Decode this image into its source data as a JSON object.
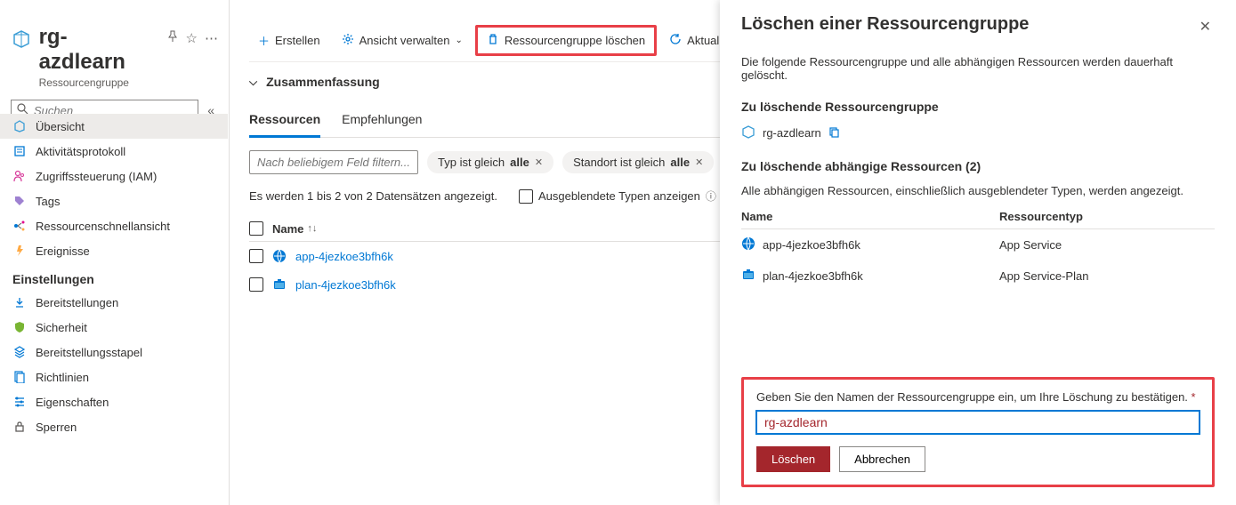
{
  "header": {
    "title": "rg-azdlearn",
    "subtitle": "Ressourcengruppe"
  },
  "search": {
    "placeholder": "Suchen"
  },
  "nav": {
    "items": [
      {
        "label": "Übersicht"
      },
      {
        "label": "Aktivitätsprotokoll"
      },
      {
        "label": "Zugriffssteuerung (IAM)"
      },
      {
        "label": "Tags"
      },
      {
        "label": "Ressourcenschnellansicht"
      },
      {
        "label": "Ereignisse"
      }
    ],
    "settings_header": "Einstellungen",
    "settings": [
      {
        "label": "Bereitstellungen"
      },
      {
        "label": "Sicherheit"
      },
      {
        "label": "Bereitstellungsstapel"
      },
      {
        "label": "Richtlinien"
      },
      {
        "label": "Eigenschaften"
      },
      {
        "label": "Sperren"
      }
    ]
  },
  "toolbar": {
    "create": "Erstellen",
    "view": "Ansicht verwalten",
    "delete": "Ressourcengruppe löschen",
    "refresh": "Aktualisie"
  },
  "summary": {
    "title": "Zusammenfassung"
  },
  "tabs": {
    "resources": "Ressourcen",
    "recommendations": "Empfehlungen"
  },
  "filters": {
    "placeholder": "Nach beliebigem Feld filtern...",
    "type_prefix": "Typ ist gleich ",
    "type_value": "alle",
    "loc_prefix": "Standort ist gleich ",
    "loc_value": "alle"
  },
  "count": {
    "text": "Es werden 1 bis 2 von 2 Datensätzen angezeigt.",
    "hidden_types": "Ausgeblendete Typen anzeigen"
  },
  "table": {
    "name_col": "Name",
    "rows": [
      {
        "name": "app-4jezkoe3bfh6k"
      },
      {
        "name": "plan-4jezkoe3bfh6k"
      }
    ]
  },
  "panel": {
    "title": "Löschen einer Ressourcengruppe",
    "intro": "Die folgende Ressourcengruppe und alle abhängigen Ressourcen werden dauerhaft gelöscht.",
    "rg_heading": "Zu löschende Ressourcengruppe",
    "rg_name": "rg-azdlearn",
    "deps_heading": "Zu löschende abhängige Ressourcen (2)",
    "deps_text": "Alle abhängigen Ressourcen, einschließlich ausgeblendeter Typen, werden angezeigt.",
    "col_name": "Name",
    "col_type": "Ressourcentyp",
    "rows": [
      {
        "name": "app-4jezkoe3bfh6k",
        "type": "App Service"
      },
      {
        "name": "plan-4jezkoe3bfh6k",
        "type": "App Service-Plan"
      }
    ],
    "confirm_label": "Geben Sie den Namen der Ressourcengruppe ein, um Ihre Löschung zu bestätigen.",
    "confirm_value": "rg-azdlearn",
    "delete_btn": "Löschen",
    "cancel_btn": "Abbrechen"
  }
}
